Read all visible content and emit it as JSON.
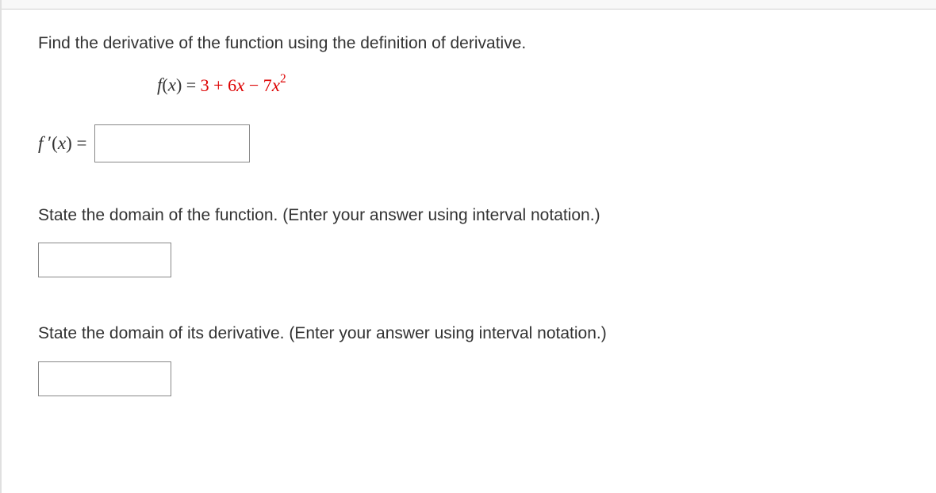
{
  "question": {
    "prompt": "Find the derivative of the function using the definition of derivative.",
    "function_lhs_f": "f",
    "function_lhs_paren": "(",
    "function_lhs_x": "x",
    "function_lhs_close": ") = ",
    "function_rhs_part1": "3 + 6",
    "function_rhs_x1": "x",
    "function_rhs_minus": " − ",
    "function_rhs_coef": "7",
    "function_rhs_x2": "x",
    "function_rhs_exp": "2"
  },
  "answer": {
    "fprime_f": "f",
    "fprime_prime": " ′",
    "fprime_paren": "(",
    "fprime_x": "x",
    "fprime_close": ") ="
  },
  "domainFunction": {
    "prompt": "State the domain of the function. (Enter your answer using interval notation.)"
  },
  "domainDerivative": {
    "prompt": "State the domain of its derivative. (Enter your answer using interval notation.)"
  }
}
